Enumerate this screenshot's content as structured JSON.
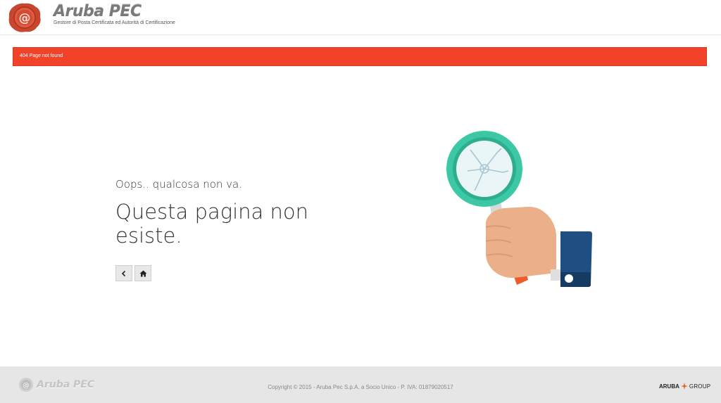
{
  "header": {
    "brand_name": "Aruba PEC",
    "tagline": "Gestore di Posta Certificata ed Autorità di Certificazione"
  },
  "alert": {
    "text": "404 Page not found",
    "color": "#f2432a"
  },
  "error": {
    "subtitle": "Oops.. qualcosa non va.",
    "title": "Questa pagina non esiste."
  },
  "actions": {
    "back_icon": "chevron-left-icon",
    "home_icon": "home-icon"
  },
  "footer": {
    "brand_name": "Aruba PEC",
    "copyright": "Copyright © 2015 - Aruba Pec S.p.A. a Socio Unico - P. IVA: 01879020517",
    "group_name_1": "ARUBA",
    "group_name_2": "GROUP"
  },
  "colors": {
    "accent_red": "#f2432a",
    "teal": "#3cc8a4",
    "skin": "#ebb08a",
    "sleeve": "#1f4f82",
    "handle": "#f05a28"
  }
}
